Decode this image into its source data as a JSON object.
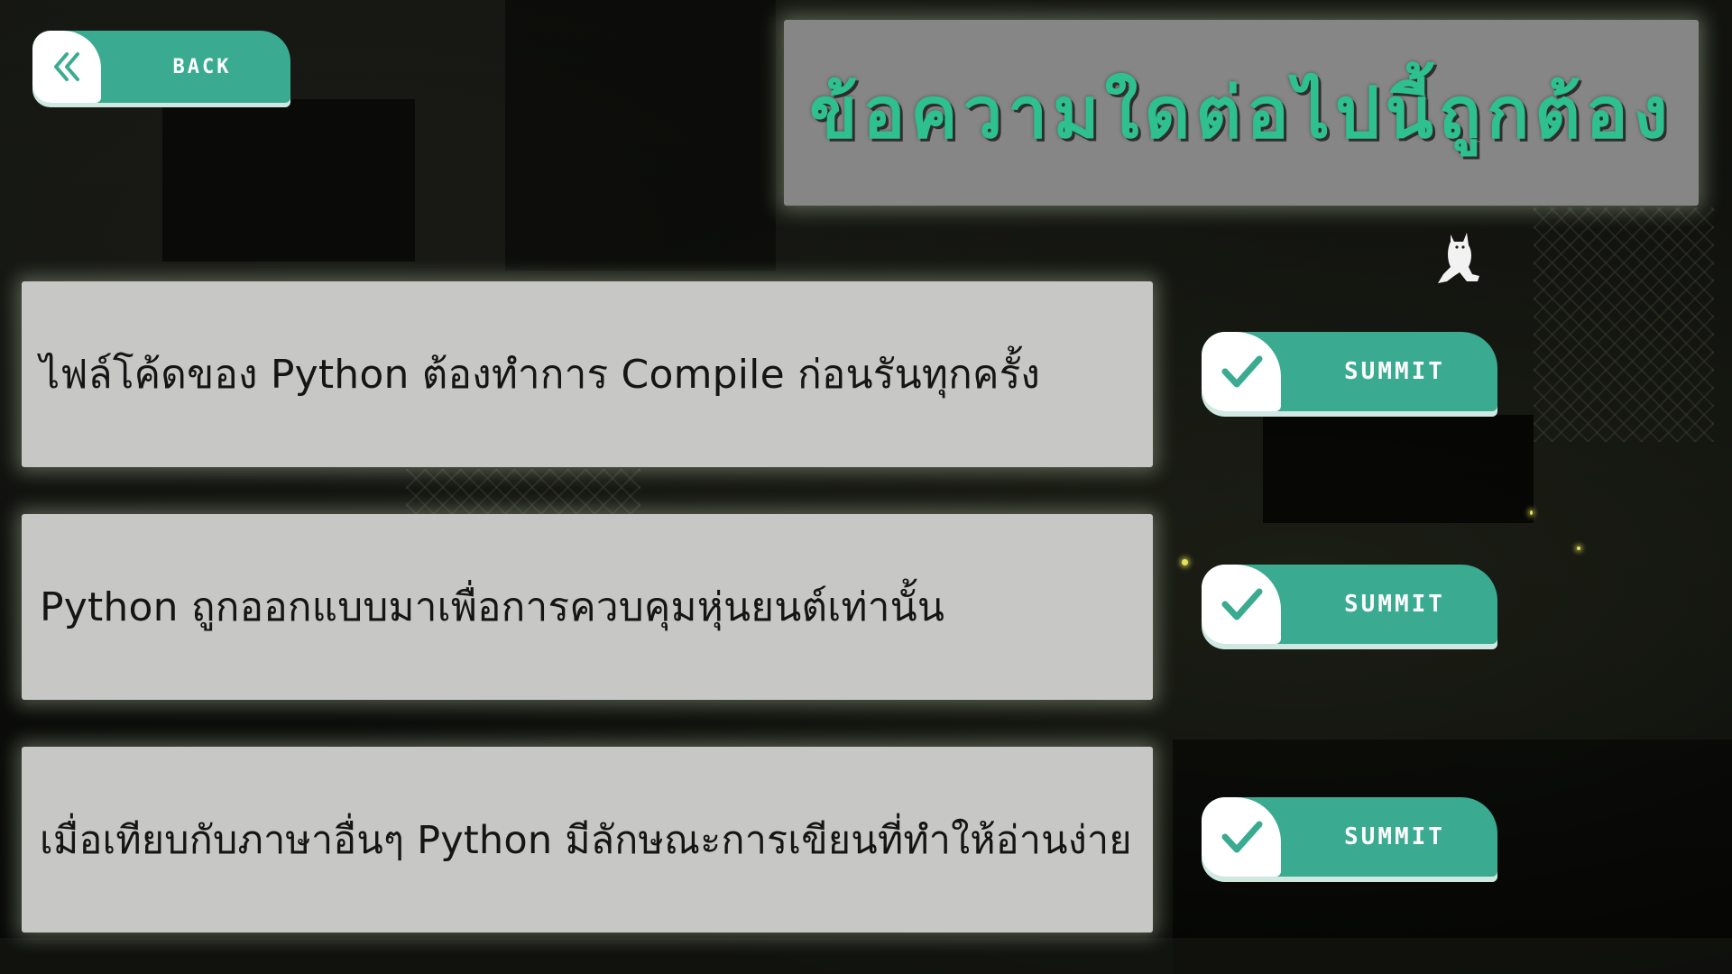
{
  "header": {
    "back_label": "BACK",
    "back_icon": "double-chevron-left-icon",
    "title": "ข้อความใดต่อไปนี้ถูกต้อง"
  },
  "questions": [
    {
      "text": "ไฟล์โค้ดของ Python ต้องทำการ Compile ก่อนรันทุกครั้ง",
      "submit_label": "SUMMIT",
      "icon": "checkmark-icon"
    },
    {
      "text": "Python ถูกออกแบบมาเพื่อการควบคุมหุ่นยนต์เท่านั้น",
      "submit_label": "SUMMIT",
      "icon": "checkmark-icon"
    },
    {
      "text": "เมื่อเทียบกับภาษาอื่นๆ Python มีลักษณะการเขียนที่ทำให้อ่านง่าย",
      "submit_label": "SUMMIT",
      "icon": "checkmark-icon"
    }
  ],
  "colors": {
    "accent": "#3aab90",
    "title_text": "#2ec08f",
    "card_bg": "#c7c7c6",
    "title_panel_bg": "#868686"
  }
}
